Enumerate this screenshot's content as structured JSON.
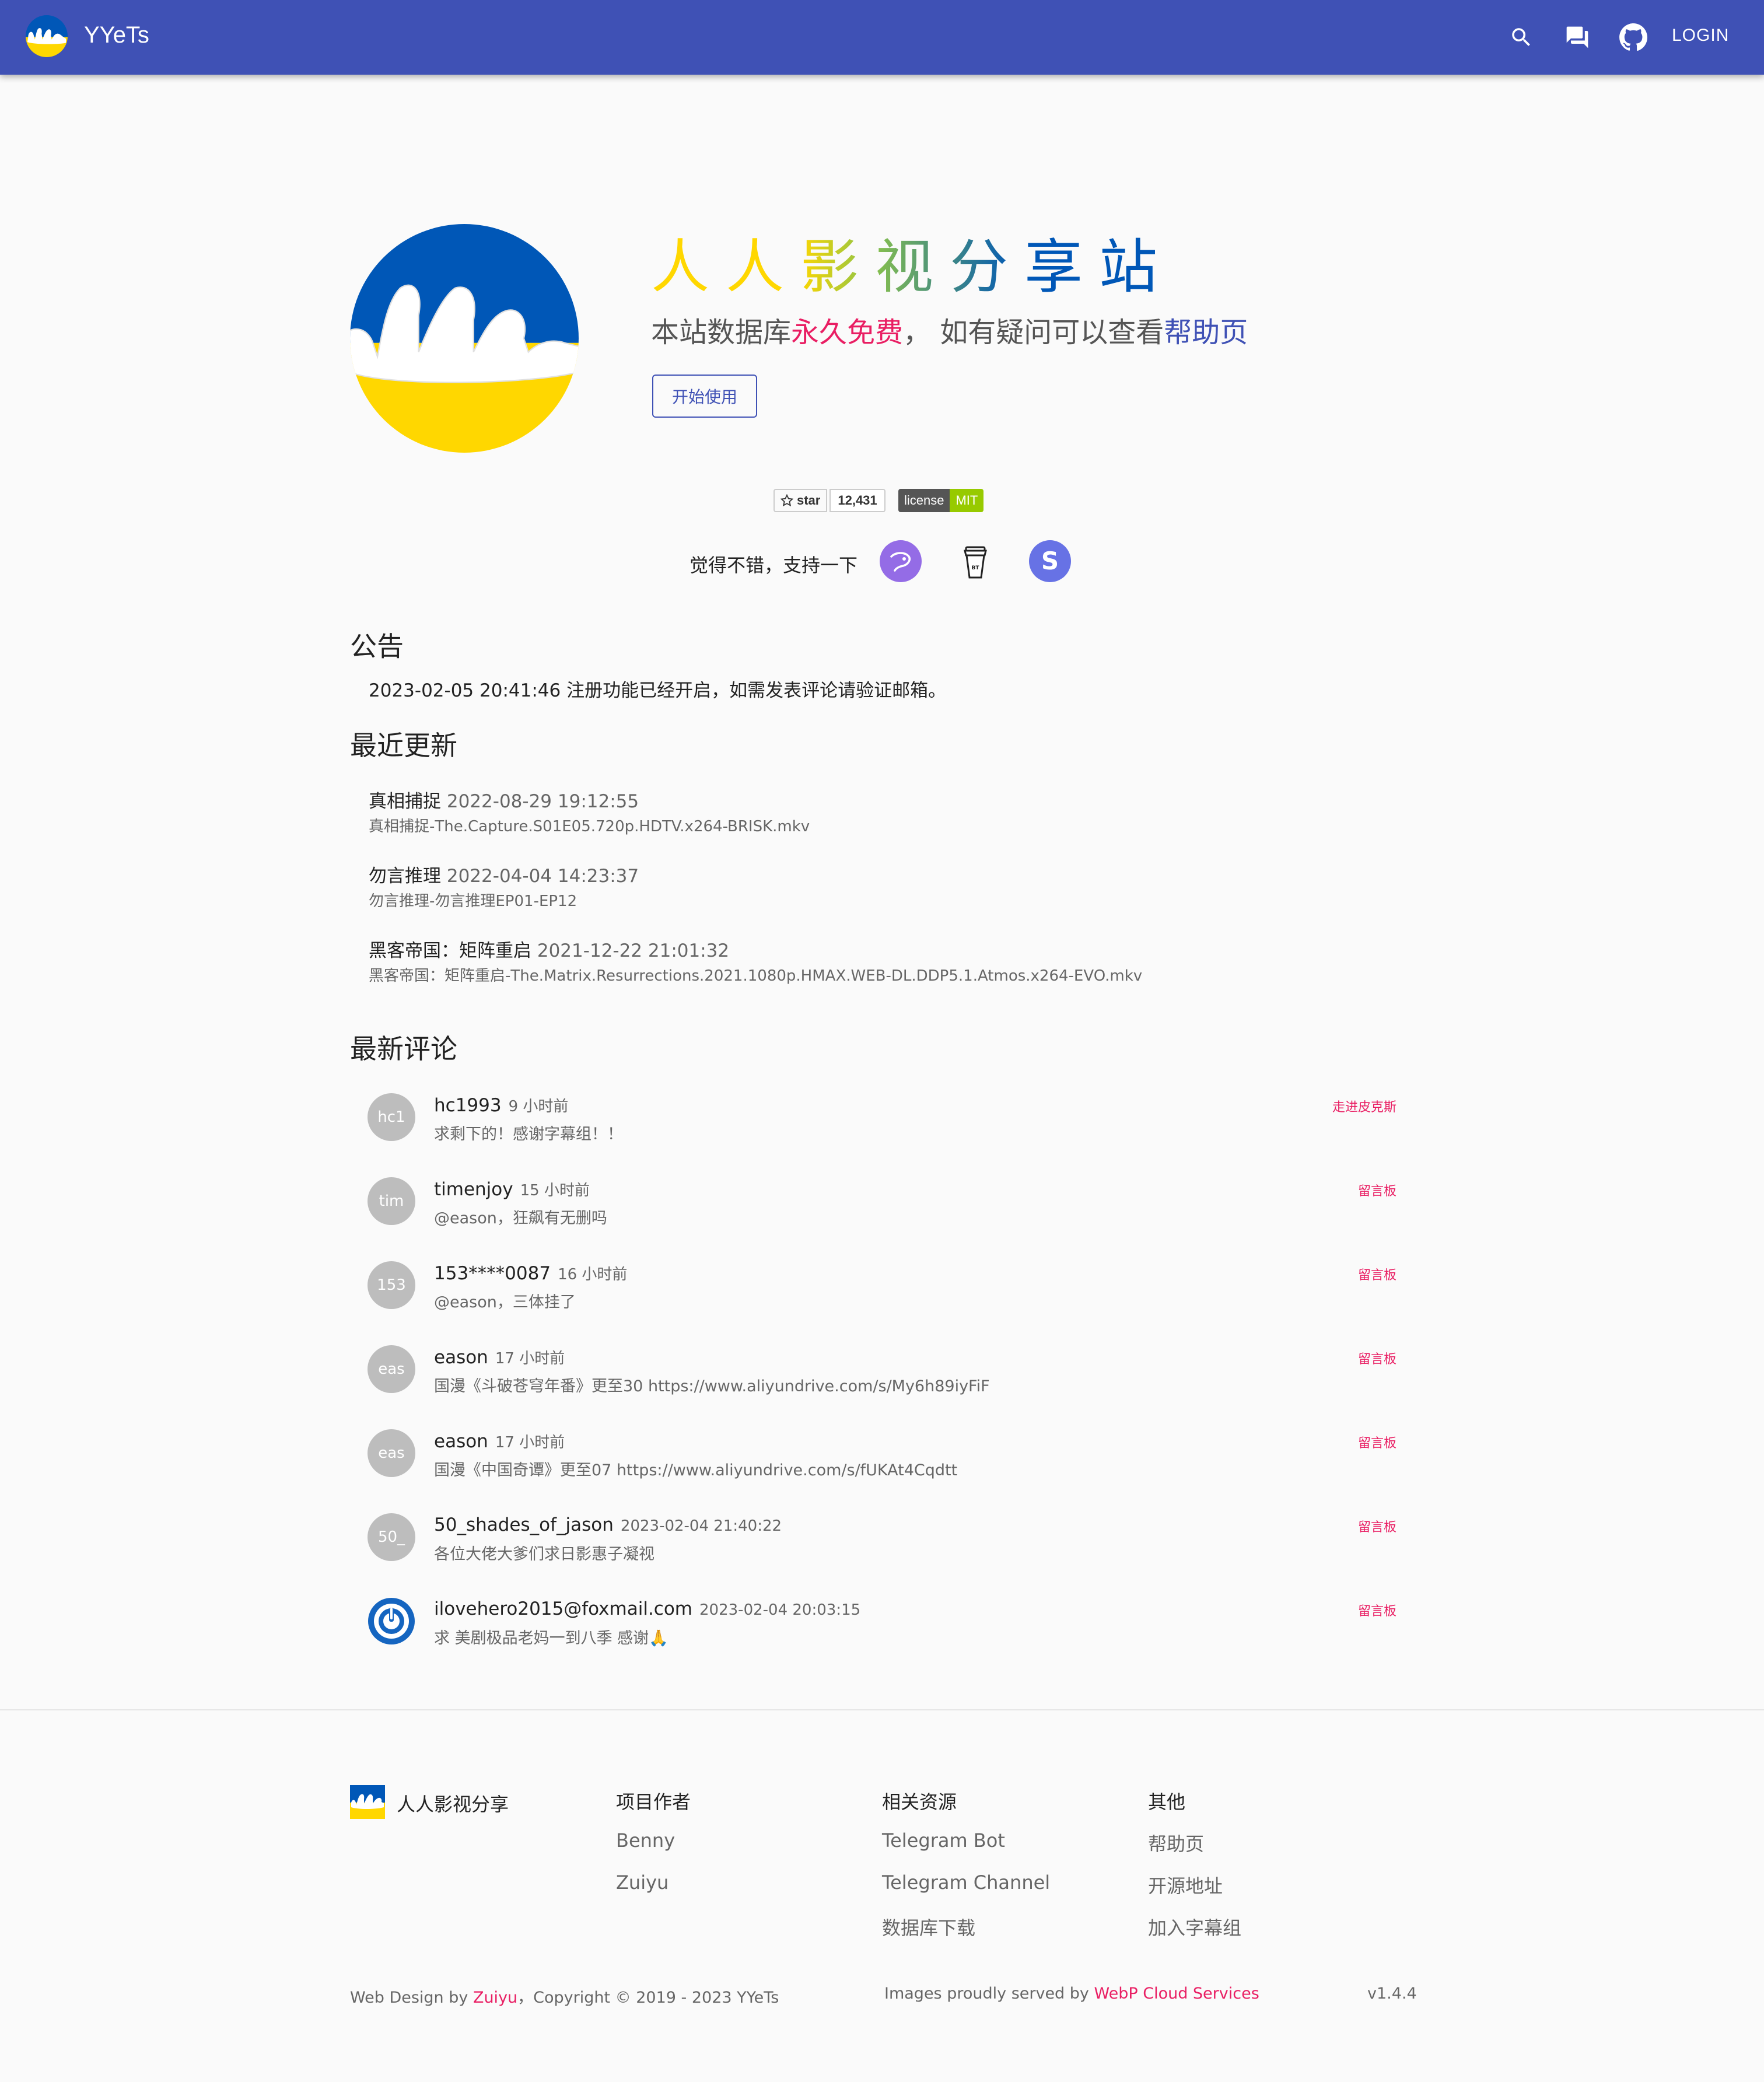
{
  "appbar": {
    "brand": "YYeTs",
    "login_label": "LOGIN"
  },
  "hero": {
    "title": "人人影视分享站",
    "subtitle_pre": "本站数据库",
    "subtitle_free": "永久免费",
    "subtitle_mid": "， 如有疑问可以查看",
    "subtitle_help": "帮助页",
    "start_label": "开始使用"
  },
  "badges": {
    "star_label": "star",
    "star_count": "12,431",
    "license_label": "license",
    "license_value": "MIT"
  },
  "support": {
    "label": "觉得不错，支持一下"
  },
  "announcement": {
    "heading": "公告",
    "text": "2023-02-05 20:41:46  注册功能已经开启，如需发表评论请验证邮箱。"
  },
  "updates": {
    "heading": "最近更新",
    "items": [
      {
        "name": "真相捕捉",
        "time": "2022-08-29 19:12:55",
        "file": "真相捕捉-The.Capture.S01E05.720p.HDTV.x264-BRISK.mkv"
      },
      {
        "name": "勿言推理",
        "time": "2022-04-04 14:23:37",
        "file": "勿言推理-勿言推理EP01-EP12"
      },
      {
        "name": "黑客帝国：矩阵重启",
        "time": "2021-12-22 21:01:32",
        "file": "黑客帝国：矩阵重启-The.Matrix.Resurrections.2021.1080p.HMAX.WEB-DL.DDP5.1.Atmos.x264-EVO.mkv"
      }
    ]
  },
  "comments": {
    "heading": "最新评论",
    "items": [
      {
        "avatar": "hc1",
        "user": "hc1993",
        "time": "9 小时前",
        "text": "求剩下的！感谢字幕组！！",
        "tag": "走进皮克斯"
      },
      {
        "avatar": "tim",
        "user": "timenjoy",
        "time": "15 小时前",
        "text": "@eason，狂飙有无删吗",
        "tag": "留言板"
      },
      {
        "avatar": "153",
        "user": "153****0087",
        "time": "16 小时前",
        "text": "@eason，三体挂了",
        "tag": "留言板"
      },
      {
        "avatar": "eas",
        "user": "eason",
        "time": "17 小时前",
        "text": "国漫《斗破苍穹年番》更至30 https://www.aliyundrive.com/s/My6h89iyFiF",
        "tag": "留言板"
      },
      {
        "avatar": "eas",
        "user": "eason",
        "time": "17 小时前",
        "text": "国漫《中国奇谭》更至07 https://www.aliyundrive.com/s/fUKAt4Cqdtt",
        "tag": "留言板"
      },
      {
        "avatar": "50_",
        "user": "50_shades_of_jason",
        "time": "2023-02-04 21:40:22",
        "text": "各位大佬大爹们求日影惠子凝视",
        "tag": "留言板"
      },
      {
        "avatar": "",
        "user": "ilovehero2015@foxmail.com",
        "time": "2023-02-04 20:03:15",
        "text": "求 美剧极品老妈一到八季 感谢🙏",
        "tag": "留言板"
      }
    ]
  },
  "footer": {
    "brand": "人人影视分享",
    "col1": {
      "heading": "项目作者",
      "links": [
        "Benny",
        "Zuiyu"
      ]
    },
    "col2": {
      "heading": "相关资源",
      "links": [
        "Telegram Bot",
        "Telegram Channel",
        "数据库下载"
      ]
    },
    "col3": {
      "heading": "其他",
      "links": [
        "帮助页",
        "开源地址",
        "加入字幕组"
      ]
    },
    "design_pre": "Web Design by ",
    "design_link": "Zuiyu",
    "copyright": "，Copyright © 2019 - 2023 YYeTs",
    "images_pre": "Images proudly served by ",
    "images_link": "WebP Cloud Services",
    "version": "v1.4.4"
  },
  "colors": {
    "primary": "#3f51b5",
    "accent": "#e91e63",
    "ukraine_blue": "#0057b7",
    "ukraine_yellow": "#ffd700"
  }
}
